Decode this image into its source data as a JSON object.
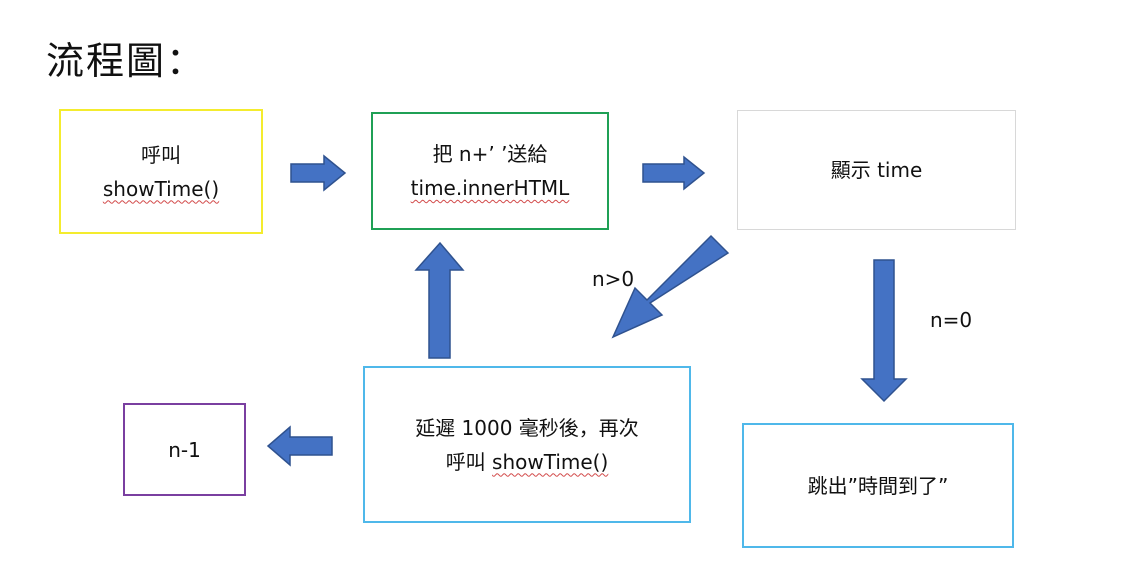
{
  "title": "流程圖：",
  "boxes": {
    "call": {
      "line1": "呼叫",
      "line2": "showTime()"
    },
    "send": {
      "line1": "把 n+’ ’送給",
      "line2": "time.innerHTML"
    },
    "display": {
      "line1": "顯示 time"
    },
    "delay": {
      "line1": "延遲 1000 毫秒後，再次",
      "line2_prefix": "呼叫 ",
      "line2_code": "showTime()"
    },
    "decrement": {
      "line1": "n-1"
    },
    "exit": {
      "line1": "跳出”時間到了”"
    }
  },
  "conditions": {
    "greater_than_zero": "n>0",
    "equals_zero": "n=0"
  },
  "colors": {
    "arrow_fill": "#4472c4",
    "arrow_stroke": "#2f528f",
    "call_border": "#f4ec2e",
    "send_border": "#1fa055",
    "display_border": "#d8d8d8",
    "delay_border": "#4fb8ea",
    "decrement_border": "#7a3fa0",
    "exit_border": "#4fb8ea"
  }
}
